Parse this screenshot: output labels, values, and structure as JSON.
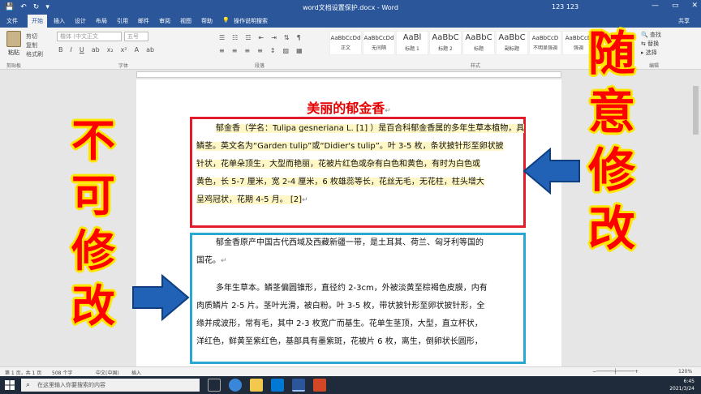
{
  "window": {
    "title": "word文档设置保护.docx  -  Word",
    "user": "123 123",
    "controls": [
      "—",
      "▭",
      "✕"
    ]
  },
  "tabs": [
    {
      "label": "文件"
    },
    {
      "label": "开始"
    },
    {
      "label": "插入"
    },
    {
      "label": "设计"
    },
    {
      "label": "布局"
    },
    {
      "label": "引用"
    },
    {
      "label": "邮件"
    },
    {
      "label": "审阅"
    },
    {
      "label": "视图"
    },
    {
      "label": "帮助"
    },
    {
      "label": "操作说明搜索"
    }
  ],
  "share": "共享",
  "ribbon": {
    "paste": "粘贴",
    "cut_copy": [
      "剪切",
      "复制",
      "格式刷"
    ],
    "font_name": "楷体 (中文正文",
    "font_size": "五号",
    "styles": [
      {
        "sample": "AaBbCcDd",
        "name": "正文"
      },
      {
        "sample": "AaBbCcDd",
        "name": "无间隔"
      },
      {
        "sample": "AaBl",
        "name": "标题 1"
      },
      {
        "sample": "AaBbC",
        "name": "标题 2"
      },
      {
        "sample": "AaBbC",
        "name": "标题"
      },
      {
        "sample": "AaBbC",
        "name": "副标题"
      },
      {
        "sample": "AaBbCcD",
        "name": "不明显强调"
      },
      {
        "sample": "AaBbCcD",
        "name": "强调"
      }
    ],
    "editing": [
      "查找",
      "替换",
      "选择"
    ],
    "groups": [
      "剪贴板",
      "字体",
      "段落",
      "样式",
      "编辑"
    ]
  },
  "document": {
    "heading": "美丽的郁金香",
    "protected_para_lines": [
      "郁金香（学名：Tulipa gesneriana L. [1] ）是百合科郁金香属的多年生草本植物，具",
      "鳞茎。英文名为“Garden tulip”或“Didier's tulip”。叶 3-5 枚，条状披针形至卵状披",
      "针状，花单朵顶生，大型而艳丽，花被片红色或杂有白色和黄色，有时为白色或",
      "黄色，长 5-7 厘米，宽 2-4 厘米，6 枚雄蕊等长，花丝无毛，无花柱，柱头增大",
      "呈鸡冠状，花期 4-5 月。 [2]"
    ],
    "para2_lines": [
      "郁金香原产中国古代西域及西藏新疆一带，是土耳其、荷兰、匈牙利等国的",
      "国花。"
    ],
    "para3_lines": [
      "多年生草本。鳞茎偏圆锥形，直径约 2-3cm，外被淡黄至棕褐色皮膜，内有",
      "肉质鳞片 2-5 片。茎叶光滑，被白粉。叶 3-5 枚，带状披针形至卵状披针形，全",
      "缘并成波形，常有毛，其中 2-3 枚宽广而基生。花单生茎顶，大型，直立杯状，",
      "洋红色，鲜黄至紫红色，基部具有墨紫斑，花被片 6 枚，离生，倒卵状长圆形，"
    ]
  },
  "callouts": {
    "left": [
      "不",
      "可",
      "修",
      "改"
    ],
    "right": [
      "随",
      "意",
      "修",
      "改"
    ]
  },
  "colors": {
    "red_box": "#e21b2d",
    "blue_box": "#2aa7d2",
    "arrow": "#2162b6",
    "callout_text": "#ff0000",
    "callout_outline": "#ffe600"
  },
  "status": {
    "page": "第 1 页，共 1 页",
    "words": "508 个字",
    "language": "中文(中国)",
    "mode": "插入",
    "zoom": "120%"
  },
  "taskbar": {
    "search_placeholder": "在这里输入你要搜索的内容",
    "time": "6:45",
    "date": "2021/3/24"
  }
}
